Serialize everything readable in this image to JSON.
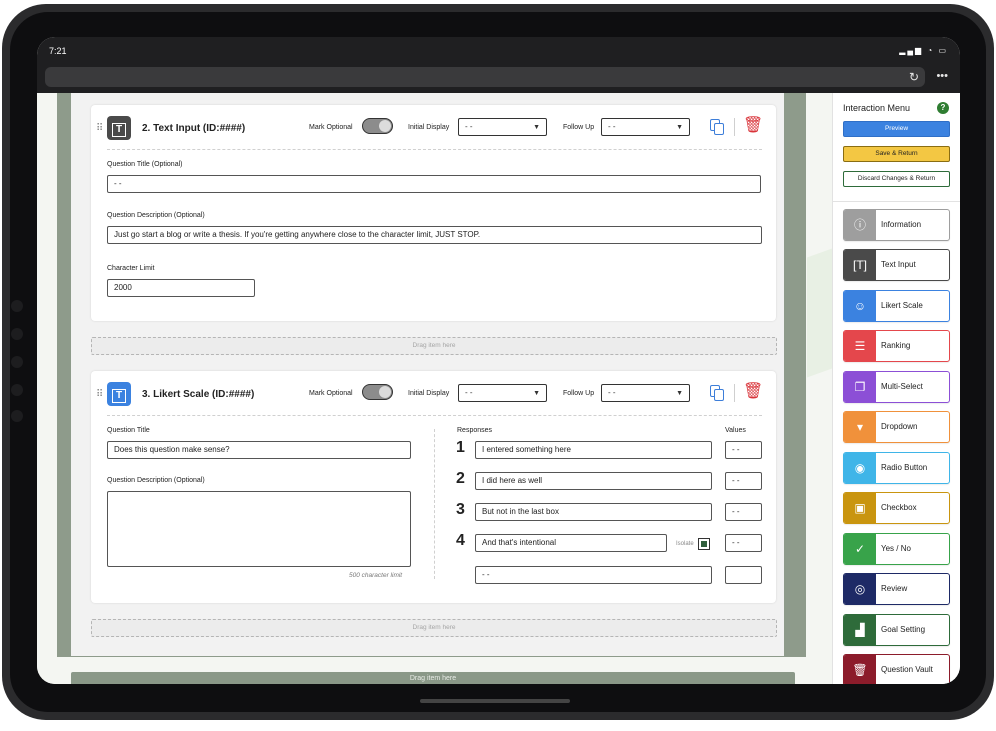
{
  "status": {
    "time": "7:21",
    "icons": "ull wifi batt"
  },
  "browser": {
    "reload_icon": "reload-icon",
    "more_icon": "more-icon"
  },
  "q2": {
    "title": "2. Text Input (ID:####)",
    "mark_optional": "Mark Optional",
    "initial_display_label": "Initial Display",
    "initial_display_value": "- -",
    "follow_up_label": "Follow Up",
    "follow_up_value": "- -",
    "question_title_label": "Question Title (Optional)",
    "question_title_value": "- -",
    "question_desc_label": "Question Description (Optional)",
    "question_desc_value": "Just go start a blog or write a thesis. If you're getting anywhere close to the character limit, JUST STOP.",
    "char_limit_label": "Character Limit",
    "char_limit_value": "2000"
  },
  "dropzone_text": "Drag item here",
  "q3": {
    "title": "3. Likert Scale (ID:####)",
    "mark_optional": "Mark Optional",
    "initial_display_label": "Initial Display",
    "initial_display_value": "- -",
    "follow_up_label": "Follow Up",
    "follow_up_value": "- -",
    "question_title_label": "Question Title",
    "question_title_value": "Does this question make sense?",
    "question_desc_label": "Question Description (Optional)",
    "char_limit_hint": "500 character limit",
    "responses_label": "Responses",
    "values_label": "Values",
    "isolate_label": "Isolate",
    "responses": [
      {
        "num": "1",
        "text": "I entered something here",
        "value": "- -"
      },
      {
        "num": "2",
        "text": "I did here as well",
        "value": "- -"
      },
      {
        "num": "3",
        "text": "But not in the last box",
        "value": "- -"
      },
      {
        "num": "4",
        "text": "And that's intentional",
        "value": "- -"
      },
      {
        "num": "",
        "text": "- -",
        "value": ""
      }
    ]
  },
  "sidebar": {
    "title": "Interaction Menu",
    "help": "?",
    "preview": "Preview",
    "save_return": "Save & Return",
    "discard_return": "Discard Changes & Return",
    "tools": [
      {
        "label": "Information",
        "color": "#9e9e9e",
        "icon": "info-icon"
      },
      {
        "label": "Text Input",
        "color": "#4a4a4a",
        "icon": "text-input-icon"
      },
      {
        "label": "Likert Scale",
        "color": "#3b82e0",
        "icon": "likert-icon"
      },
      {
        "label": "Ranking",
        "color": "#e4474c",
        "icon": "ranking-icon"
      },
      {
        "label": "Multi-Select",
        "color": "#8c4fd6",
        "icon": "multi-select-icon"
      },
      {
        "label": "Dropdown",
        "color": "#f0913b",
        "icon": "dropdown-icon"
      },
      {
        "label": "Radio Button",
        "color": "#3fb5e8",
        "icon": "radio-icon"
      },
      {
        "label": "Checkbox",
        "color": "#c9950f",
        "icon": "checkbox-icon"
      },
      {
        "label": "Yes / No",
        "color": "#38a34a",
        "icon": "yes-no-icon"
      },
      {
        "label": "Review",
        "color": "#1e2a66",
        "icon": "review-icon"
      },
      {
        "label": "Goal Setting",
        "color": "#2e6b3a",
        "icon": "goal-icon"
      },
      {
        "label": "Question Vault",
        "color": "#8c1c2b",
        "icon": "vault-icon"
      }
    ]
  }
}
